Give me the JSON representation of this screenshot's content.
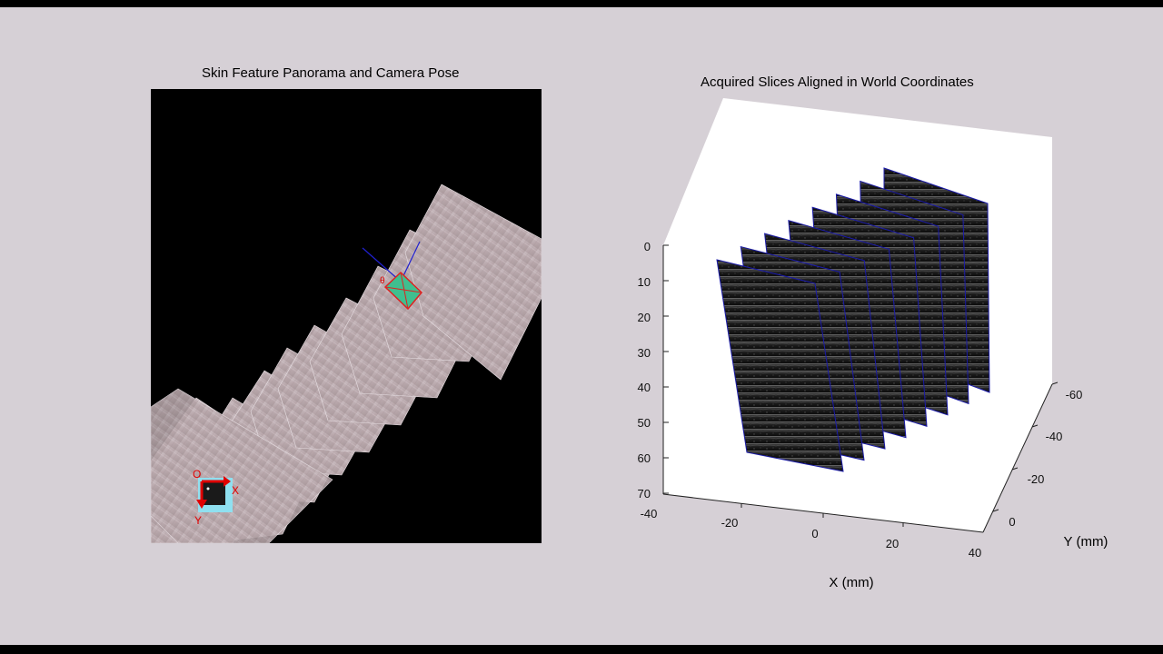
{
  "left_panel": {
    "title": "Skin Feature Panorama and Camera Pose",
    "origin_marker": {
      "o_label": "O",
      "x_label": "X",
      "y_label": "Y"
    },
    "pose_marker_label": "θ"
  },
  "right_panel": {
    "title": "Acquired Slices Aligned in World Coordinates",
    "x_axis": {
      "label": "X (mm)",
      "ticks": [
        "-40",
        "-20",
        "0",
        "20",
        "40"
      ]
    },
    "y_axis": {
      "label": "Y (mm)",
      "ticks": [
        "-60",
        "-40",
        "-20",
        "0"
      ]
    },
    "z_axis": {
      "ticks": [
        "0",
        "10",
        "20",
        "30",
        "40",
        "50",
        "60",
        "70"
      ]
    },
    "slice_count": 8
  },
  "colors": {
    "figure_bg": "#d6d0d6",
    "slice_edge": "#1a1aa8",
    "pose_box_fill": "#3fbf8f",
    "pose_box_edge": "#e02020",
    "marker_red": "#e00000",
    "marker_cyan": "#8fe0f0"
  }
}
